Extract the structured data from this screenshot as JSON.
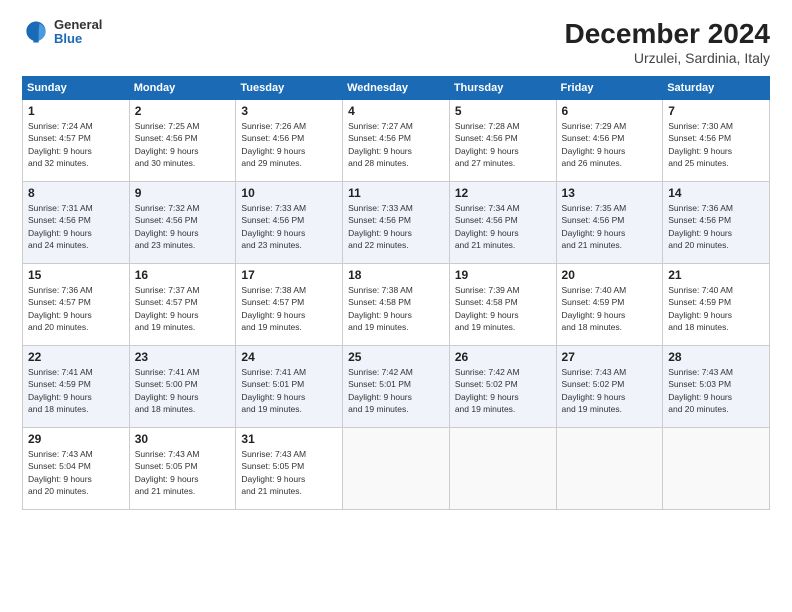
{
  "logo": {
    "general": "General",
    "blue": "Blue"
  },
  "title": "December 2024",
  "subtitle": "Urzulei, Sardinia, Italy",
  "weekdays": [
    "Sunday",
    "Monday",
    "Tuesday",
    "Wednesday",
    "Thursday",
    "Friday",
    "Saturday"
  ],
  "weeks": [
    [
      {
        "day": "1",
        "info": "Sunrise: 7:24 AM\nSunset: 4:57 PM\nDaylight: 9 hours\nand 32 minutes."
      },
      {
        "day": "2",
        "info": "Sunrise: 7:25 AM\nSunset: 4:56 PM\nDaylight: 9 hours\nand 30 minutes."
      },
      {
        "day": "3",
        "info": "Sunrise: 7:26 AM\nSunset: 4:56 PM\nDaylight: 9 hours\nand 29 minutes."
      },
      {
        "day": "4",
        "info": "Sunrise: 7:27 AM\nSunset: 4:56 PM\nDaylight: 9 hours\nand 28 minutes."
      },
      {
        "day": "5",
        "info": "Sunrise: 7:28 AM\nSunset: 4:56 PM\nDaylight: 9 hours\nand 27 minutes."
      },
      {
        "day": "6",
        "info": "Sunrise: 7:29 AM\nSunset: 4:56 PM\nDaylight: 9 hours\nand 26 minutes."
      },
      {
        "day": "7",
        "info": "Sunrise: 7:30 AM\nSunset: 4:56 PM\nDaylight: 9 hours\nand 25 minutes."
      }
    ],
    [
      {
        "day": "8",
        "info": "Sunrise: 7:31 AM\nSunset: 4:56 PM\nDaylight: 9 hours\nand 24 minutes."
      },
      {
        "day": "9",
        "info": "Sunrise: 7:32 AM\nSunset: 4:56 PM\nDaylight: 9 hours\nand 23 minutes."
      },
      {
        "day": "10",
        "info": "Sunrise: 7:33 AM\nSunset: 4:56 PM\nDaylight: 9 hours\nand 23 minutes."
      },
      {
        "day": "11",
        "info": "Sunrise: 7:33 AM\nSunset: 4:56 PM\nDaylight: 9 hours\nand 22 minutes."
      },
      {
        "day": "12",
        "info": "Sunrise: 7:34 AM\nSunset: 4:56 PM\nDaylight: 9 hours\nand 21 minutes."
      },
      {
        "day": "13",
        "info": "Sunrise: 7:35 AM\nSunset: 4:56 PM\nDaylight: 9 hours\nand 21 minutes."
      },
      {
        "day": "14",
        "info": "Sunrise: 7:36 AM\nSunset: 4:56 PM\nDaylight: 9 hours\nand 20 minutes."
      }
    ],
    [
      {
        "day": "15",
        "info": "Sunrise: 7:36 AM\nSunset: 4:57 PM\nDaylight: 9 hours\nand 20 minutes."
      },
      {
        "day": "16",
        "info": "Sunrise: 7:37 AM\nSunset: 4:57 PM\nDaylight: 9 hours\nand 19 minutes."
      },
      {
        "day": "17",
        "info": "Sunrise: 7:38 AM\nSunset: 4:57 PM\nDaylight: 9 hours\nand 19 minutes."
      },
      {
        "day": "18",
        "info": "Sunrise: 7:38 AM\nSunset: 4:58 PM\nDaylight: 9 hours\nand 19 minutes."
      },
      {
        "day": "19",
        "info": "Sunrise: 7:39 AM\nSunset: 4:58 PM\nDaylight: 9 hours\nand 19 minutes."
      },
      {
        "day": "20",
        "info": "Sunrise: 7:40 AM\nSunset: 4:59 PM\nDaylight: 9 hours\nand 18 minutes."
      },
      {
        "day": "21",
        "info": "Sunrise: 7:40 AM\nSunset: 4:59 PM\nDaylight: 9 hours\nand 18 minutes."
      }
    ],
    [
      {
        "day": "22",
        "info": "Sunrise: 7:41 AM\nSunset: 4:59 PM\nDaylight: 9 hours\nand 18 minutes."
      },
      {
        "day": "23",
        "info": "Sunrise: 7:41 AM\nSunset: 5:00 PM\nDaylight: 9 hours\nand 18 minutes."
      },
      {
        "day": "24",
        "info": "Sunrise: 7:41 AM\nSunset: 5:01 PM\nDaylight: 9 hours\nand 19 minutes."
      },
      {
        "day": "25",
        "info": "Sunrise: 7:42 AM\nSunset: 5:01 PM\nDaylight: 9 hours\nand 19 minutes."
      },
      {
        "day": "26",
        "info": "Sunrise: 7:42 AM\nSunset: 5:02 PM\nDaylight: 9 hours\nand 19 minutes."
      },
      {
        "day": "27",
        "info": "Sunrise: 7:43 AM\nSunset: 5:02 PM\nDaylight: 9 hours\nand 19 minutes."
      },
      {
        "day": "28",
        "info": "Sunrise: 7:43 AM\nSunset: 5:03 PM\nDaylight: 9 hours\nand 20 minutes."
      }
    ],
    [
      {
        "day": "29",
        "info": "Sunrise: 7:43 AM\nSunset: 5:04 PM\nDaylight: 9 hours\nand 20 minutes."
      },
      {
        "day": "30",
        "info": "Sunrise: 7:43 AM\nSunset: 5:05 PM\nDaylight: 9 hours\nand 21 minutes."
      },
      {
        "day": "31",
        "info": "Sunrise: 7:43 AM\nSunset: 5:05 PM\nDaylight: 9 hours\nand 21 minutes."
      },
      {
        "day": "",
        "info": ""
      },
      {
        "day": "",
        "info": ""
      },
      {
        "day": "",
        "info": ""
      },
      {
        "day": "",
        "info": ""
      }
    ]
  ]
}
